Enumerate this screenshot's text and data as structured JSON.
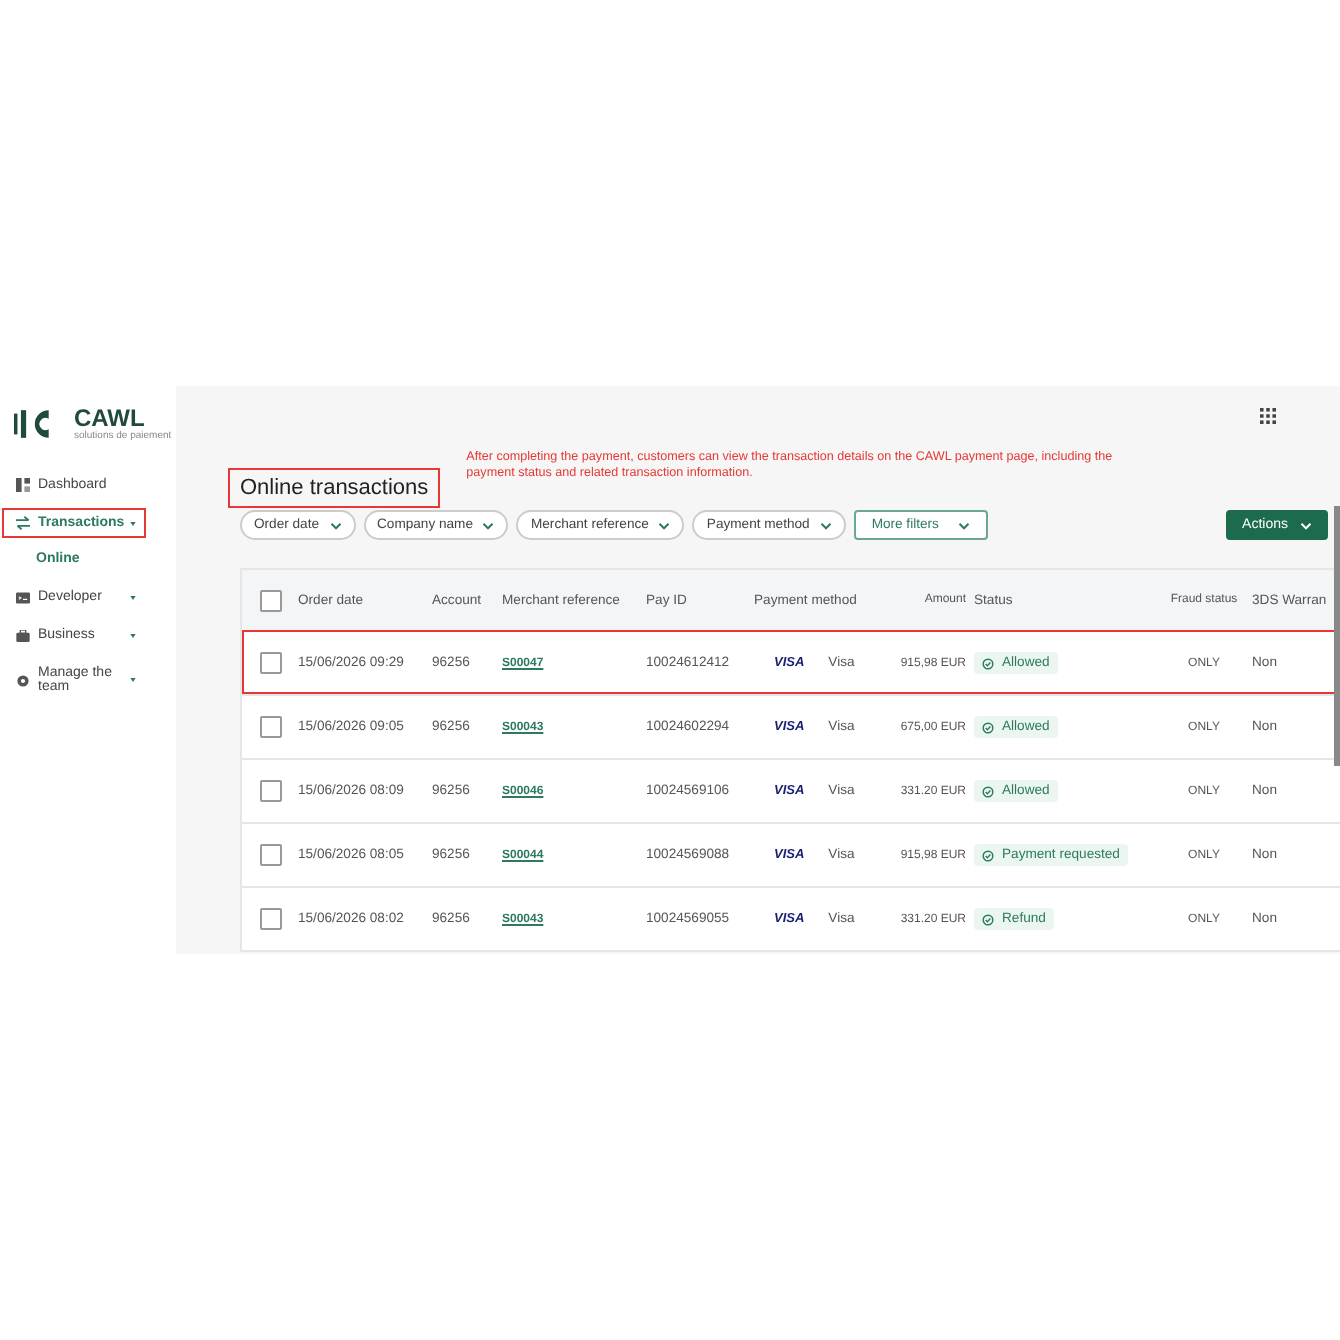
{
  "logo": {
    "name": "CAWL",
    "tagline": "solutions de paiement"
  },
  "sidebar": {
    "items": [
      {
        "label": "Dashboard",
        "selected": false,
        "highlighted": false,
        "expandable": false
      },
      {
        "label": "Transactions",
        "selected": true,
        "highlighted": true,
        "expandable": true,
        "children": [
          {
            "label": "Online",
            "selected": true
          }
        ]
      },
      {
        "label": "Developer",
        "selected": false,
        "highlighted": false,
        "expandable": true
      },
      {
        "label": "Business",
        "selected": false,
        "highlighted": false,
        "expandable": true
      },
      {
        "label": "Manage the team",
        "selected": false,
        "highlighted": false,
        "expandable": true
      }
    ]
  },
  "page": {
    "title": "Online transactions",
    "title_highlighted": true,
    "annotation": "After completing the payment, customers can view the transaction details on the CAWL payment page, including the payment status and related transaction information."
  },
  "filters": [
    {
      "label": "Order date",
      "kind": "dropdown"
    },
    {
      "label": "Company name",
      "kind": "dropdown"
    },
    {
      "label": "Merchant reference",
      "kind": "dropdown"
    },
    {
      "label": "Payment method",
      "kind": "dropdown"
    },
    {
      "label": "More filters",
      "kind": "more"
    }
  ],
  "actions_button": "Actions",
  "table": {
    "select_all_checked": false,
    "columns": [
      "Order date",
      "Account",
      "Merchant reference",
      "Pay ID",
      "Payment method",
      "Amount",
      "Status",
      "Fraud status",
      "3DS Warran"
    ],
    "rows": [
      {
        "checked": false,
        "highlighted": true,
        "order_date": "15/06/2026 09:29",
        "account": "96256",
        "merchant_reference": "S00047",
        "pay_id": "10024612412",
        "card_brand": "VISA",
        "payment_method": "Visa",
        "amount": "915,98 EUR",
        "status": "Allowed",
        "fraud_status": "ONLY",
        "three_ds": "Non"
      },
      {
        "checked": false,
        "highlighted": false,
        "order_date": "15/06/2026 09:05",
        "account": "96256",
        "merchant_reference": "S00043",
        "pay_id": "10024602294",
        "card_brand": "VISA",
        "payment_method": "Visa",
        "amount": "675,00 EUR",
        "status": "Allowed",
        "fraud_status": "ONLY",
        "three_ds": "Non"
      },
      {
        "checked": false,
        "highlighted": false,
        "order_date": "15/06/2026 08:09",
        "account": "96256",
        "merchant_reference": "S00046",
        "pay_id": "10024569106",
        "card_brand": "VISA",
        "payment_method": "Visa",
        "amount": "331.20 EUR",
        "status": "Allowed",
        "fraud_status": "ONLY",
        "three_ds": "Non"
      },
      {
        "checked": false,
        "highlighted": false,
        "order_date": "15/06/2026 08:05",
        "account": "96256",
        "merchant_reference": "S00044",
        "pay_id": "10024569088",
        "card_brand": "VISA",
        "payment_method": "Visa",
        "amount": "915,98 EUR",
        "status": "Payment requested",
        "fraud_status": "ONLY",
        "three_ds": "Non"
      },
      {
        "checked": false,
        "highlighted": false,
        "order_date": "15/06/2026 08:02",
        "account": "96256",
        "merchant_reference": "S00043",
        "pay_id": "10024569055",
        "card_brand": "VISA",
        "payment_method": "Visa",
        "amount": "331.20 EUR",
        "status": "Refund",
        "fraud_status": "ONLY",
        "three_ds": "Non"
      }
    ]
  }
}
